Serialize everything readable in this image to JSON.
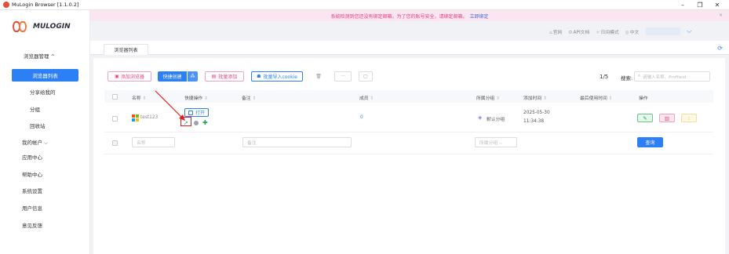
{
  "window": {
    "title": "MuLogin Browser  [1.1.0.2]",
    "controls": [
      "–",
      "❐",
      "✕"
    ]
  },
  "notice": {
    "text": "系统检测到您还没有绑定邮箱，为了您的账号安全，请绑定邮箱。",
    "link": "立即绑定",
    "close": "×"
  },
  "brand": {
    "name": "MULOGIN"
  },
  "header": {
    "items": [
      "官网",
      "API文档",
      "日间模式",
      "中文"
    ],
    "dropdown": "⌵"
  },
  "sidebar": {
    "items": [
      {
        "label": "浏览器管理  ^"
      },
      {
        "label": "浏览器列表"
      },
      {
        "label": "分享给我的"
      },
      {
        "label": "分组"
      },
      {
        "label": "回收站"
      },
      {
        "label": "我的帐户  ⌵"
      },
      {
        "label": "应用中心"
      },
      {
        "label": "帮助中心"
      },
      {
        "label": "系统设置"
      },
      {
        "label": "用户信息"
      },
      {
        "label": "意见反馈"
      }
    ]
  },
  "tabs": {
    "active": "浏览器列表",
    "refresh_icon": "⟳"
  },
  "toolbar": {
    "add_browser": "添加浏览器",
    "quick_create": "快捷创建",
    "batch_add": "批量添加",
    "batch_import_cookie": "批量导入cookie",
    "more": "···"
  },
  "pagination": {
    "text": "1/5"
  },
  "search": {
    "label": "搜索:",
    "placeholder": "请输入名称、Profileid"
  },
  "table": {
    "headers": {
      "name": "名称",
      "quick_ops": "快捷操作",
      "remark": "备注",
      "members": "成员",
      "group": "所属分组",
      "added_time": "添加时间",
      "last_used": "最后使用时间",
      "actions": "操作"
    },
    "sort_icon": "⇕",
    "rows": [
      {
        "name": "test123",
        "open": "打开",
        "members": "0",
        "group": "默认分组",
        "added_date": "2025-05-30",
        "added_time": "11:34:38"
      }
    ],
    "filters": {
      "name_placeholder": "名称",
      "remark_placeholder": "备注",
      "group_placeholder": "所属分组  ⌵",
      "query": "查询"
    }
  },
  "colors": {
    "primary": "#2d7ff5",
    "danger": "#e0447a",
    "notice_bg": "#fbe5f0"
  }
}
